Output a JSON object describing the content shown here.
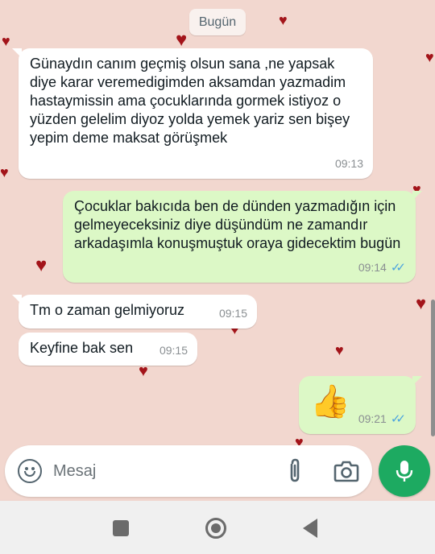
{
  "date_chip": "Bugün",
  "messages": [
    {
      "dir": "in",
      "text": "Günaydın canım geçmiş olsun  sana ,ne yapsak diye karar veremedigimden aksamdan yazmadim  hastaymissin ama çocuklarında gormek istiyoz o yüzden gelelim diyoz yolda yemek yariz sen bişey yepim deme maksat görüşmek",
      "time": "09:13"
    },
    {
      "dir": "out",
      "text": "Çocuklar bakıcıda ben de dünden yazmadığın için gelmeyeceksiniz diye düşündüm ne zamandır arkadaşımla konuşmuştuk oraya gidecektim bugün",
      "time": "09:14",
      "status": "read"
    },
    {
      "dir": "in",
      "text": "Tm o zaman gelmiyoruz",
      "time": "09:15"
    },
    {
      "dir": "in",
      "text": "Keyfine bak sen",
      "time": "09:15"
    },
    {
      "dir": "out",
      "text": "👍",
      "time": "09:21",
      "status": "read"
    }
  ],
  "input": {
    "placeholder": "Mesaj"
  },
  "icons": {
    "emoji": "emoji-icon",
    "attach": "paperclip-icon",
    "camera": "camera-icon",
    "mic": "microphone-icon",
    "read_receipt": "double-check-icon"
  },
  "colors": {
    "chat_bg": "#f2d7cf",
    "incoming": "#ffffff",
    "outgoing": "#dcf8c6",
    "accent": "#1daa61",
    "read_tick": "#4aa3df",
    "heart": "#a3141a"
  }
}
